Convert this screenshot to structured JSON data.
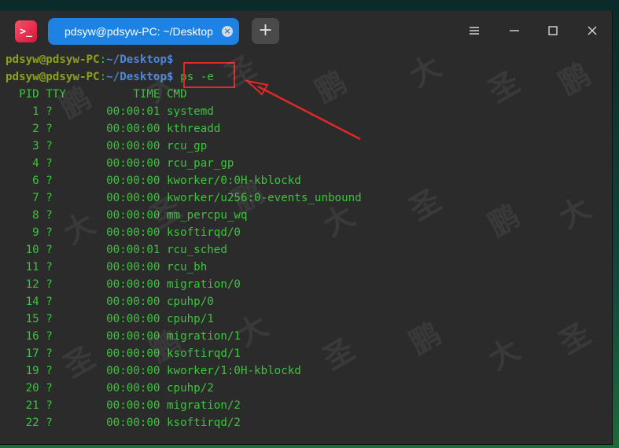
{
  "window": {
    "app_icon": ">_",
    "tab_title": "pdsyw@pdsyw-PC: ~/Desktop",
    "new_tab_label": "+",
    "menu_icon": "hamburger-menu-icon",
    "minimize_icon": "minimize-icon",
    "maximize_icon": "maximize-icon",
    "close_icon": "close-icon"
  },
  "terminal": {
    "prompt_user": "pdsyw@pdsyw-PC",
    "prompt_colon": ":",
    "prompt_path": "~/Desktop$",
    "command": " ps -e",
    "header": "  PID TTY          TIME CMD",
    "rows": [
      "    1 ?        00:00:01 systemd",
      "    2 ?        00:00:00 kthreadd",
      "    3 ?        00:00:00 rcu_gp",
      "    4 ?        00:00:00 rcu_par_gp",
      "    6 ?        00:00:00 kworker/0:0H-kblockd",
      "    7 ?        00:00:00 kworker/u256:0-events_unbound",
      "    8 ?        00:00:00 mm_percpu_wq",
      "    9 ?        00:00:00 ksoftirqd/0",
      "   10 ?        00:00:01 rcu_sched",
      "   11 ?        00:00:00 rcu_bh",
      "   12 ?        00:00:00 migration/0",
      "   14 ?        00:00:00 cpuhp/0",
      "   15 ?        00:00:00 cpuhp/1",
      "   16 ?        00:00:00 migration/1",
      "   17 ?        00:00:00 ksoftirqd/1",
      "   19 ?        00:00:00 kworker/1:0H-kblockd",
      "   20 ?        00:00:00 cpuhp/2",
      "   21 ?        00:00:00 migration/2",
      "   22 ?        00:00:00 ksoftirqd/2"
    ]
  },
  "annotation": {
    "box_color": "#e02828",
    "arrow_color": "#e02828"
  },
  "watermark": {
    "chars": [
      "鹏",
      "大",
      "圣"
    ]
  }
}
